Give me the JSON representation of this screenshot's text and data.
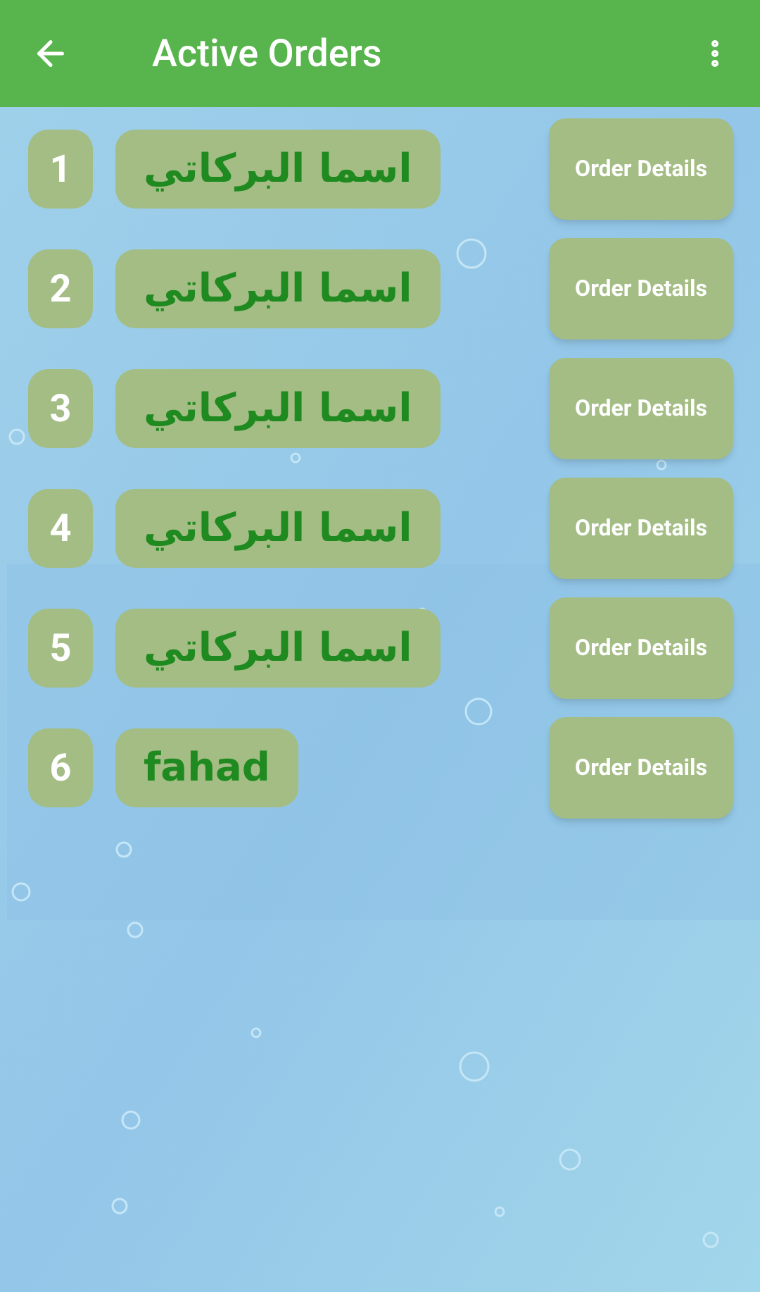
{
  "app_bar": {
    "title": "Active Orders"
  },
  "orders": [
    {
      "number": "1",
      "customer": "اسما البركاتي",
      "action": "Order Details"
    },
    {
      "number": "2",
      "customer": "اسما البركاتي",
      "action": "Order Details"
    },
    {
      "number": "3",
      "customer": "اسما البركاتي",
      "action": "Order Details"
    },
    {
      "number": "4",
      "customer": "اسما البركاتي",
      "action": "Order Details"
    },
    {
      "number": "5",
      "customer": "اسما البركاتي",
      "action": "Order Details"
    },
    {
      "number": "6",
      "customer": "fahad",
      "action": "Order Details"
    }
  ]
}
